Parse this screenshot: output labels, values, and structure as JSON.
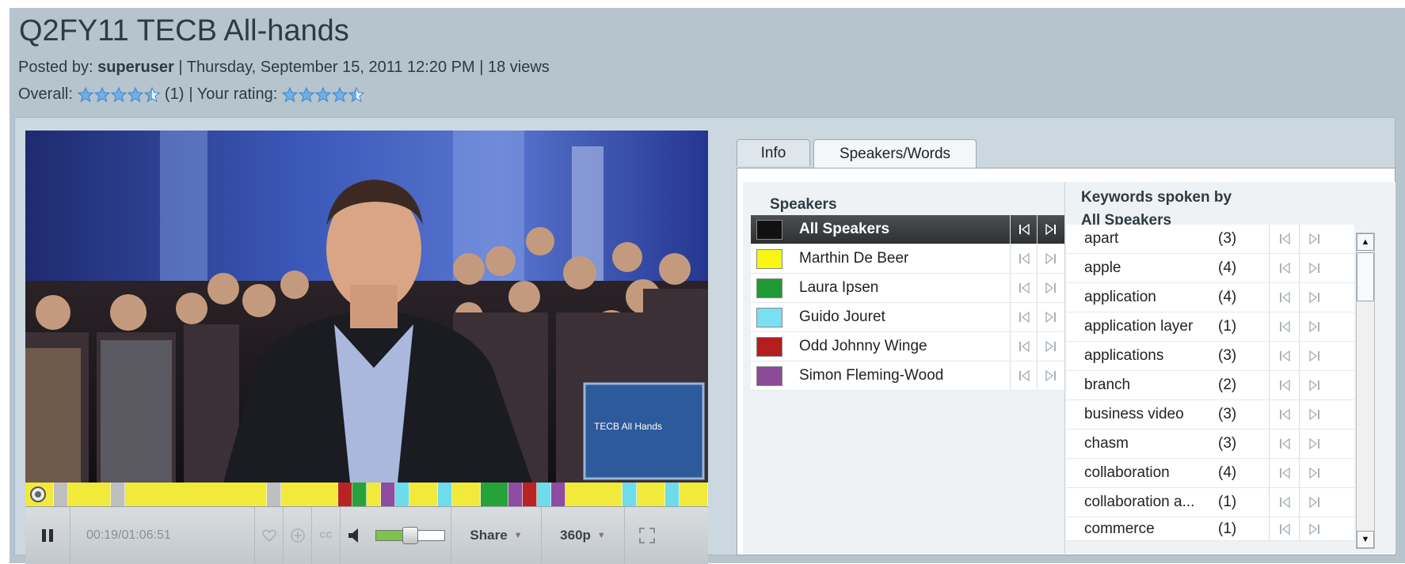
{
  "page": {
    "title": "Q2FY11 TECB All-hands",
    "posted_by_label": "Posted by:",
    "posted_by_user": "superuser",
    "posted_date": "| Thursday, September 15, 2011 12:20 PM",
    "views": "| 18 views",
    "overall_label": "Overall:",
    "overall_count": "(1)",
    "your_rating_label": "| Your rating:",
    "overall_rating": 4.5,
    "your_rating": 4.5
  },
  "video": {
    "overlay_text": "TECB All Hands",
    "time": "00:19/01:06:51",
    "playback_position": 0.005,
    "share_label": "Share",
    "quality_label": "360p",
    "cc_label": "CC",
    "volume_level": 0.5,
    "timeline_segments": [
      {
        "c": "#f2ea3a",
        "w": 2
      },
      {
        "c": "#bfbfbf",
        "w": 1
      },
      {
        "c": "#f2ea3a",
        "w": 3
      },
      {
        "c": "#bfbfbf",
        "w": 1
      },
      {
        "c": "#f2ea3a",
        "w": 10
      },
      {
        "c": "#bfbfbf",
        "w": 1
      },
      {
        "c": "#f2ea3a",
        "w": 4
      },
      {
        "c": "#b82424",
        "w": 1
      },
      {
        "c": "#27a23a",
        "w": 1
      },
      {
        "c": "#f2ea3a",
        "w": 1
      },
      {
        "c": "#8e4da0",
        "w": 1
      },
      {
        "c": "#6fdcec",
        "w": 1
      },
      {
        "c": "#f2ea3a",
        "w": 2
      },
      {
        "c": "#6fdcec",
        "w": 1
      },
      {
        "c": "#f2ea3a",
        "w": 2
      },
      {
        "c": "#27a23a",
        "w": 2
      },
      {
        "c": "#8e4da0",
        "w": 1
      },
      {
        "c": "#b82424",
        "w": 1
      },
      {
        "c": "#6fdcec",
        "w": 1
      },
      {
        "c": "#8e4da0",
        "w": 1
      },
      {
        "c": "#f2ea3a",
        "w": 4
      },
      {
        "c": "#6fdcec",
        "w": 1
      },
      {
        "c": "#f2ea3a",
        "w": 2
      },
      {
        "c": "#6fdcec",
        "w": 1
      },
      {
        "c": "#f2ea3a",
        "w": 2
      }
    ]
  },
  "tabs": {
    "info": "Info",
    "speakers_words": "Speakers/Words"
  },
  "speakers": {
    "heading": "Speakers",
    "items": [
      {
        "name": "All Speakers",
        "color": "#111111",
        "selected": true
      },
      {
        "name": "Marthin De Beer",
        "color": "#f7f713",
        "selected": false
      },
      {
        "name": "Laura Ipsen",
        "color": "#1f9a36",
        "selected": false
      },
      {
        "name": "Guido Jouret",
        "color": "#7ae0f2",
        "selected": false
      },
      {
        "name": "Odd Johnny Winge",
        "color": "#b51e1e",
        "selected": false
      },
      {
        "name": "Simon Fleming-Wood",
        "color": "#8b4b97",
        "selected": false
      }
    ]
  },
  "keywords": {
    "heading_line1": "Keywords spoken by",
    "heading_line2": "All Speakers",
    "items": [
      {
        "word": "apart",
        "count": "(3)"
      },
      {
        "word": "apple",
        "count": "(4)"
      },
      {
        "word": "application",
        "count": "(4)"
      },
      {
        "word": "application layer",
        "count": "(1)"
      },
      {
        "word": "applications",
        "count": "(3)"
      },
      {
        "word": "branch",
        "count": "(2)"
      },
      {
        "word": "business video",
        "count": "(3)"
      },
      {
        "word": "chasm",
        "count": "(3)"
      },
      {
        "word": "collaboration",
        "count": "(4)"
      },
      {
        "word": "collaboration a...",
        "count": "(1)"
      },
      {
        "word": "commerce",
        "count": "(1)"
      }
    ]
  }
}
